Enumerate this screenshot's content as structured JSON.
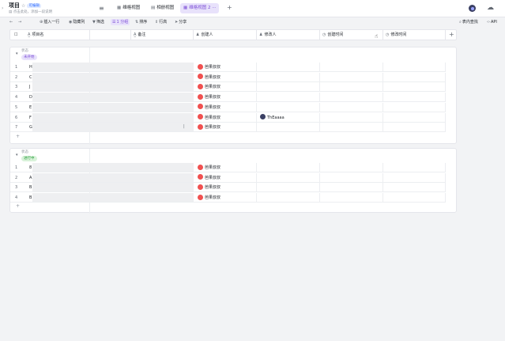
{
  "header": {
    "title": "项目",
    "badge": "可编辑",
    "subtitle": "点击此处，添加一段说明",
    "tabs": [
      {
        "label": "维格视图",
        "icon": "grid-icon"
      },
      {
        "label": "相册视图",
        "icon": "gallery-icon"
      },
      {
        "label": "维格视图 2",
        "icon": "grid-icon",
        "active": true
      }
    ]
  },
  "toolbar": {
    "insert": "插入一行",
    "hidden": "隐藏列",
    "filter": "筛选",
    "group": "1 分组",
    "sort": "排序",
    "row_height": "行高",
    "share": "分享",
    "search": "表内查找",
    "api": "API"
  },
  "columns": [
    "项目名",
    "备注",
    "创建人",
    "修改人",
    "创建时间",
    "修改时间"
  ],
  "group_field_label": "状态",
  "groups": [
    {
      "status": "未开始",
      "rows": [
        {
          "num": "1",
          "name": "H",
          "creator": "芭果叔叔",
          "modifier": ""
        },
        {
          "num": "2",
          "name": "C",
          "creator": "芭果叔叔",
          "modifier": ""
        },
        {
          "num": "3",
          "name": "J",
          "creator": "芭果叔叔",
          "modifier": ""
        },
        {
          "num": "4",
          "name": "D",
          "creator": "芭果叔叔",
          "modifier": ""
        },
        {
          "num": "5",
          "name": "E",
          "creator": "芭果叔叔",
          "modifier": ""
        },
        {
          "num": "6",
          "name": "F",
          "creator": "芭果叔叔",
          "modifier": "ThEaaaa"
        },
        {
          "num": "7",
          "name": "G",
          "creator": "芭果叔叔",
          "modifier": ""
        }
      ]
    },
    {
      "status": "进行中",
      "rows": [
        {
          "num": "1",
          "name": "8",
          "creator": "芭果叔叔",
          "modifier": ""
        },
        {
          "num": "2",
          "name": "A",
          "creator": "芭果叔叔",
          "modifier": ""
        },
        {
          "num": "3",
          "name": "B",
          "creator": "芭果叔叔",
          "modifier": ""
        },
        {
          "num": "4",
          "name": "B",
          "creator": "芭果叔叔",
          "modifier": ""
        }
      ]
    }
  ],
  "colors": {
    "accent": "#7c4dd6",
    "avatar_red": "#f05050",
    "tag_notstarted_bg": "#e8e2fb",
    "tag_inprogress_bg": "#d8f2d9"
  }
}
